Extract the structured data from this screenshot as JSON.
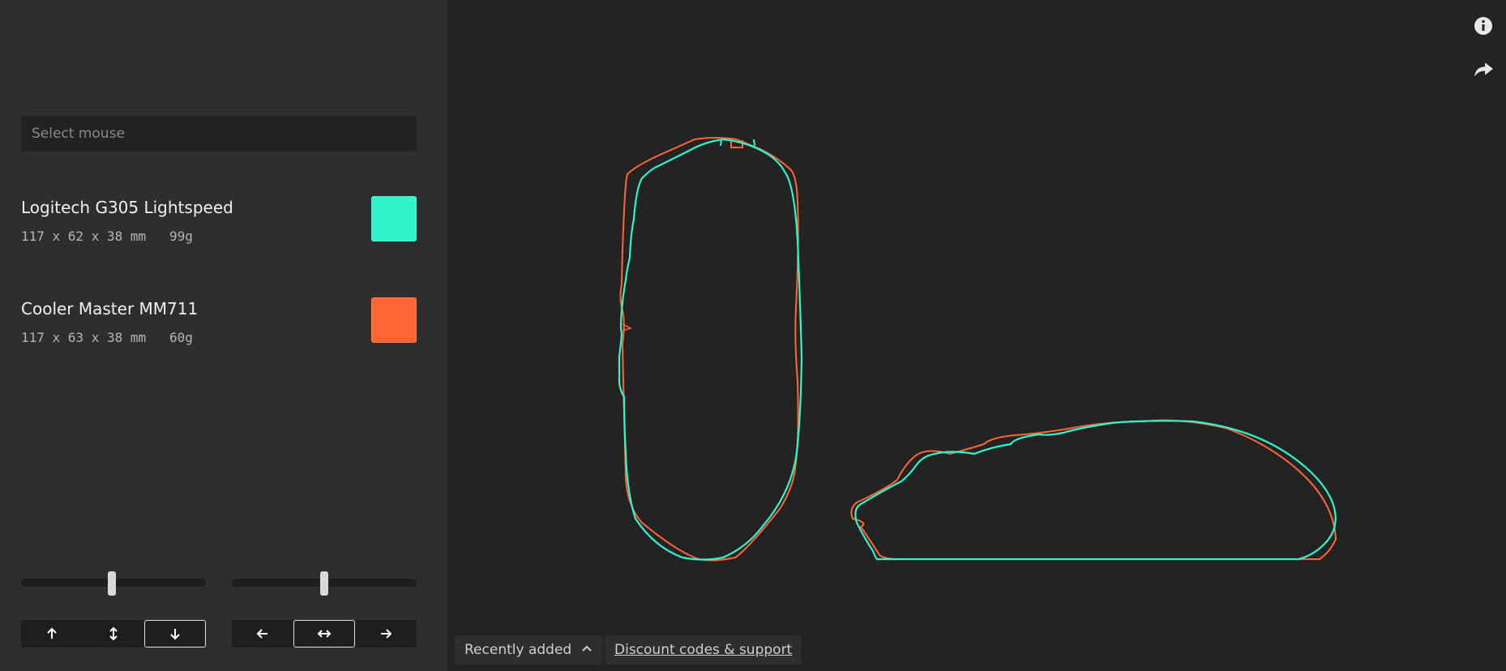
{
  "sidebar": {
    "select_placeholder": "Select mouse",
    "mice": [
      {
        "name": "Logitech G305 Lightspeed",
        "specs": "117 x 62 x 38 mm   99g",
        "color": "#2ef5cc"
      },
      {
        "name": "Cooler Master MM711",
        "specs": "117 x 63 x 38 mm   60g",
        "color": "#ff6633"
      }
    ],
    "vertical_slider_value": 0.49,
    "horizontal_slider_value": 0.5,
    "vertical_align": [
      "align-up-icon",
      "align-vertical-center-icon",
      "align-down-icon"
    ],
    "vertical_align_active": 2,
    "horizontal_align": [
      "align-left-icon",
      "align-horizontal-center-icon",
      "align-right-icon"
    ],
    "horizontal_align_active": 1
  },
  "toolbar": {
    "info_icon": "info-icon",
    "share_icon": "share-icon"
  },
  "footer": {
    "recently_added_label": "Recently added",
    "discount_label": "Discount codes & support"
  }
}
